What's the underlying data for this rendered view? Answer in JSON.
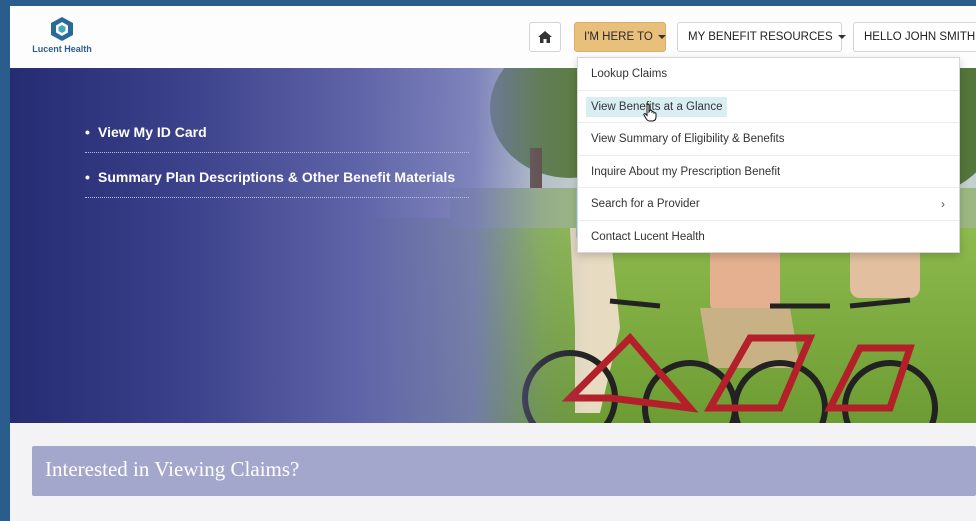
{
  "header": {
    "logo_text": "Lucent Health",
    "nav": {
      "home_icon": "home-icon",
      "here_label": "I'M HERE TO",
      "resources_label": "MY BENEFIT RESOURCES",
      "hello_label": "HELLO JOHN SMITH"
    }
  },
  "hero": {
    "links": [
      {
        "label": "View My ID Card"
      },
      {
        "label": "Summary Plan Descriptions & Other Benefit Materials"
      }
    ]
  },
  "dropdown": {
    "items": [
      {
        "label": "Lookup Claims"
      },
      {
        "label": "View Benefits at a Glance"
      },
      {
        "label": "View Summary of Eligibility & Benefits"
      },
      {
        "label": "Inquire About my Prescription Benefit"
      },
      {
        "label": "Search for a Provider",
        "arrow": "›"
      },
      {
        "label": "Contact Lucent Health"
      }
    ]
  },
  "claims_banner": {
    "title": "Interested in Viewing Claims?"
  },
  "colors": {
    "accent_button": "#e9bf7c",
    "hero_blue": "#2d357a",
    "banner": "#a4a7cc",
    "frame_border": "#2a5d8c"
  }
}
